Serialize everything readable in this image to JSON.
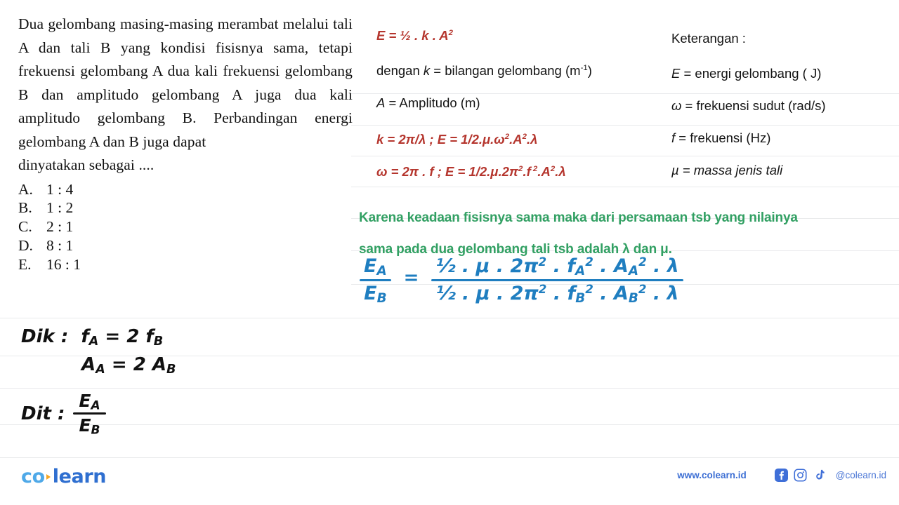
{
  "question": {
    "body": "Dua gelombang masing-masing merambat melalui tali A dan tali B yang kondisi fisisnya sama, tetapi frekuensi gelombang A dua kali frekuensi gelombang B dan amplitudo gelombang A juga dua kali amplitudo gelombang B. Perbandingan energi gelombang A dan B juga dapat",
    "last_line": "dinyatakan sebagai ....",
    "options": [
      {
        "letter": "A.",
        "value": "1 : 4"
      },
      {
        "letter": "B.",
        "value": "1 : 2"
      },
      {
        "letter": "C.",
        "value": "2 : 1"
      },
      {
        "letter": "D.",
        "value": "8 : 1"
      },
      {
        "letter": "E.",
        "value": "16 : 1"
      }
    ]
  },
  "formulas": {
    "line1_html": "E = ½ . k . A<sup>2</sup>",
    "line1_plain": "E = ½ . k . A2",
    "line2_html": "dengan <i>k</i> = bilangan gelombang (m<sup>-1</sup>)",
    "line2_plain": "dengan k = bilangan gelombang (m-1)",
    "line3_html": "<i>A</i> = Amplitudo (m)",
    "line3_plain": "A = Amplitudo (m)",
    "line4_html": "k = 2π/<b>λ</b> ; E = 1/2.μ.ω<sup>2</sup>.A<sup>2</sup>.λ",
    "line4_plain": "k = 2π/λ ; E = 1/2.μ.ω2.A2.λ",
    "line5_html": "ω = 2π . f ; E = 1/2.μ.2π<sup>2</sup>.f<sup> 2</sup>.A<sup>2</sup>.λ",
    "line5_plain": "ω = 2π . f ; E = 1/2.μ.2π2.f 2.A2.λ"
  },
  "keterangan": {
    "heading": "Keterangan :",
    "items": [
      {
        "html": "<i>E</i> = energi gelombang ( J)",
        "plain": "E = energi gelombang ( J)"
      },
      {
        "html": "<i>ω</i> = frekuensi sudut (rad/s)",
        "plain": "ω = frekuensi sudut (rad/s)"
      },
      {
        "html": "<i>f</i> = frekuensi (Hz)",
        "plain": "f = frekuensi (Hz)"
      },
      {
        "html": "<i>µ = massa jenis tali</i>",
        "plain": "µ = massa jenis tali"
      }
    ]
  },
  "green_note": {
    "line1": "Karena keadaan fisisnya sama maka dari persamaan tsb yang nilainya",
    "line2": "sama pada dua gelombang tali tsb adalah λ dan μ."
  },
  "handwriting": {
    "blue_fraction": {
      "lhs_numerator_html": "E<sub>A</sub>",
      "lhs_denominator_html": "E<sub>B</sub>",
      "equals": "=",
      "rhs_numerator_html": "½ . μ . 2π<sup>2</sup> . f<sub>A</sub><sup>2</sup> . A<sub>A</sub><sup>2</sup> . λ",
      "rhs_denominator_html": "½ . μ . 2π<sup>2</sup> . f<sub>B</sub><sup>2</sup> . A<sub>B</sub><sup>2</sup> . λ",
      "rhs_numerator_plain": "1/2 . μ . 2π2 . fA2 . AA2 . λ",
      "rhs_denominator_plain": "1/2 . μ . 2π2 . fB2 . AB2 . λ"
    },
    "dik": {
      "label": "Dik :",
      "line1_html": "f<sub>A</sub> = 2 f<sub>B</sub>",
      "line1_plain": "fA = 2 fB",
      "line2_html": "A<sub>A</sub> = 2 A<sub>B</sub>",
      "line2_plain": "AA = 2 AB"
    },
    "dit": {
      "label": "Dit :",
      "numerator_html": "E<sub>A</sub>",
      "denominator_html": "E<sub>B</sub>",
      "numerator_plain": "EA",
      "denominator_plain": "EB"
    }
  },
  "footer": {
    "logo_co": "co",
    "logo_learn": "learn",
    "website": "www.colearn.id",
    "handle": "@colearn.id",
    "social_icons": [
      "facebook-icon",
      "instagram-icon",
      "tiktok-icon"
    ]
  },
  "colors": {
    "red_formula": "#b5362e",
    "green_note": "#32a063",
    "blue_handwriting": "#1f7ec0",
    "black_text": "#111111",
    "rule_line": "#e9eaec",
    "logo_co": "#4fa9e8",
    "logo_learn": "#2f6fd0",
    "footer_blue": "#3d6fd4"
  }
}
